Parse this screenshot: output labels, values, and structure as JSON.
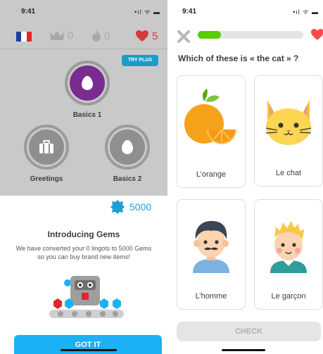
{
  "left": {
    "status": {
      "time": "9:41",
      "system": "•ıl ᯤ ▬"
    },
    "topbar": {
      "crowns": "0",
      "streak": "0",
      "hearts": "5"
    },
    "try_plus": "TRY PLUS",
    "skills": [
      {
        "label": "Basics 1"
      },
      {
        "label": "Greetings"
      },
      {
        "label": "Basics 2"
      }
    ],
    "gems_count": "5000",
    "intro_title": "Introducing Gems",
    "intro_body": "We have converted your 0 lingots to 5000 Gems so you can buy brand new items!",
    "got_it": "GOT IT",
    "colors": {
      "flag_blue": "#1f3f9b",
      "flag_red": "#e0262b",
      "gem_blue": "#1ca0d6",
      "button_blue": "#1cb0f6",
      "active_skill": "#7a2b8f"
    }
  },
  "right": {
    "status": {
      "time": "9:41",
      "system": "•ıl ᯤ ▬"
    },
    "progress": 0.22,
    "question": "Which of these is « the cat » ?",
    "choices": [
      {
        "label": "L’orange",
        "icon": "orange-icon"
      },
      {
        "label": "Le chat",
        "icon": "cat-icon"
      },
      {
        "label": "L’homme",
        "icon": "man-icon"
      },
      {
        "label": "Le garçon",
        "icon": "boy-icon"
      }
    ],
    "check": "CHECK",
    "colors": {
      "progress_green": "#58cc02",
      "heart_red": "#ff4b4b"
    }
  }
}
